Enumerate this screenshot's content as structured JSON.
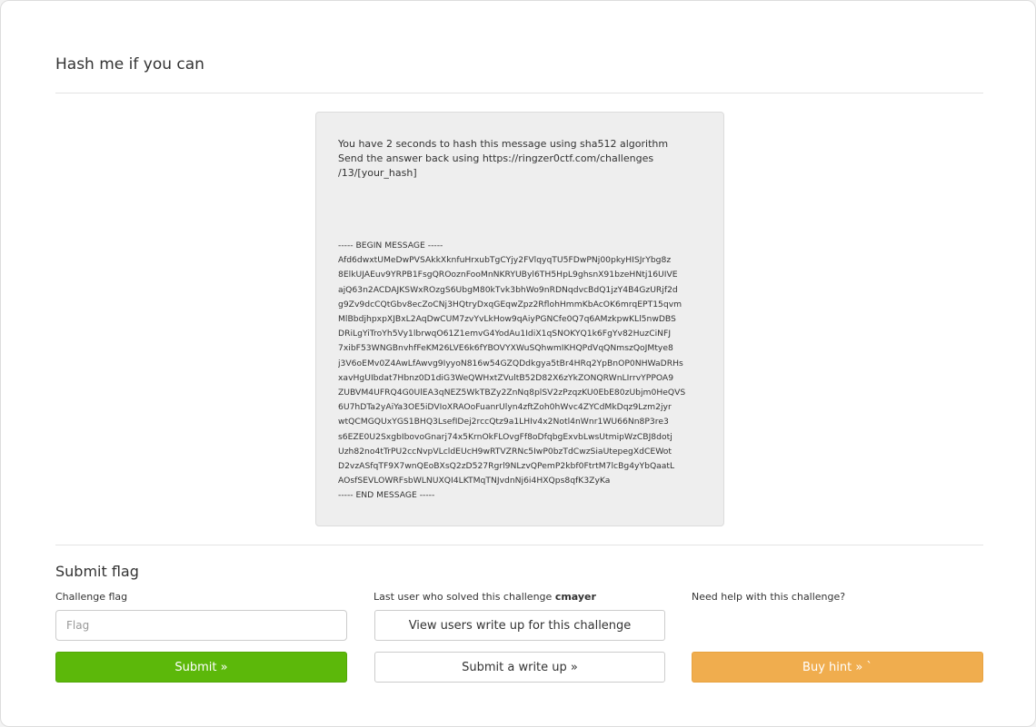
{
  "challenge": {
    "title": "Hash me if you can",
    "intro": "You have 2 seconds to hash this message using sha512 algorithm\nSend the answer back using https://ringzer0ctf.com/challenges\n/13/[your_hash]",
    "message_begin": "----- BEGIN MESSAGE -----",
    "message_lines": [
      "Afd6dwxtUMeDwPVSAkkXknfuHrxubTgCYjy2FVlqyqTU5FDwPNj00pkyHISJrYbg8z",
      "8ElkUJAEuv9YRPB1FsgQROoznFooMnNKRYUByl6TH5HpL9ghsnX91bzeHNtj16UIVE",
      "ajQ63n2ACDAJKSWxROzgS6UbgM80kTvk3bhWo9nRDNqdvcBdQ1jzY4B4GzURjf2d",
      "g9Zv9dcCQtGbv8ecZoCNj3HQtryDxqGEqwZpz2RflohHmmKbAcOK6mrqEPT15qvm",
      "MlBbdjhpxpXJBxL2AqDwCUM7zvYvLkHow9qAiyPGNCfe0Q7q6AMzkpwKLl5nwDBS",
      "DRiLgYiTroYh5Vy1lbrwqO61Z1emvG4YodAu1IdiX1qSNOKYQ1k6FgYv82HuzCiNFJ",
      "7xibF53WNGBnvhfFeKM26LVE6k6fYBOVYXWuSQhwmIKHQPdVqQNmszQoJMtye8",
      "j3V6oEMv0Z4AwLfAwvg9IyyoN816w54GZQDdkgya5tBr4HRq2YpBnOP0NHWaDRHs",
      "xavHgUIbdat7Hbnz0D1diG3WeQWHxtZVultB52D82X6zYkZONQRWnLIrrvYPPOA9",
      "ZUBVM4UFRQ4G0UlEA3qNEZ5WkTBZy2ZnNq8plSV2zPzqzKU0EbE80zUbjm0HeQVS",
      "6U7hDTa2yAiYa3OE5iDVIoXRAOoFuanrUlyn4zftZoh0hWvc4ZYCdMkDqz9Lzm2jyr",
      "wtQCMGQUxYGS1BHQ3LsefIDej2rccQtz9a1LHIv4x2Notl4nWnr1WU66Nn8P3re3",
      "s6EZE0U2SxgbIbovoGnarj74x5KrnOkFLOvgFf8oDfqbgExvbLwsUtmipWzCBJ8dotj",
      "Uzh82no4tTrPU2ccNvpVLcldEUcH9wRTVZRNc5IwP0bzTdCwzSiaUtepegXdCEWot",
      "D2vzASfqTF9X7wnQEoBXsQ2zD527Rgrl9NLzvQPemP2kbf0FtrtM7lcBg4yYbQaatL",
      "AOsfSEVLOWRFsbWLNUXQI4LKTMqTNJvdnNj6i4HXQps8qfK3ZyKa"
    ],
    "message_end": "----- END MESSAGE -----"
  },
  "submit_section": {
    "title": "Submit flag",
    "flag_label": "Challenge flag",
    "flag_placeholder": "Flag",
    "submit_button": "Submit »",
    "last_user_prefix": "Last user who solved this challenge",
    "last_user_name": "cmayer",
    "view_writeup_button": "View users write up for this challenge",
    "submit_writeup_button": "Submit a write up »",
    "help_label": "Need help with this challenge?",
    "buy_hint_button": "Buy hint » `"
  },
  "colors": {
    "submit_green": "#5cb80a",
    "hint_orange": "#f0ad4e",
    "message_box_bg": "#eeeeee"
  }
}
